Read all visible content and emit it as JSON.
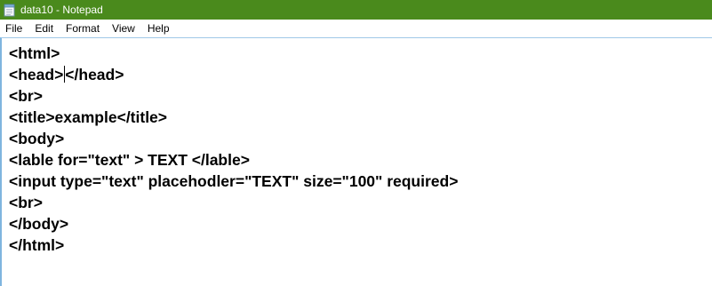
{
  "window": {
    "title": "data10 - Notepad",
    "titlebar_color": "#4a8a1c",
    "icon": "notepad-icon"
  },
  "menu": {
    "items": [
      "File",
      "Edit",
      "Format",
      "View",
      "Help"
    ]
  },
  "editor": {
    "lines": [
      "<html>",
      "<head></head>",
      "<br>",
      "<title>example</title>",
      "<body>",
      "<lable for=\"text\" > TEXT </lable>",
      "<input type=\"text\" placehodler=\"TEXT\" size=\"100\" required>",
      "<br>",
      "</body>",
      "</html>"
    ],
    "caret": {
      "line": 1,
      "column": 6
    }
  }
}
